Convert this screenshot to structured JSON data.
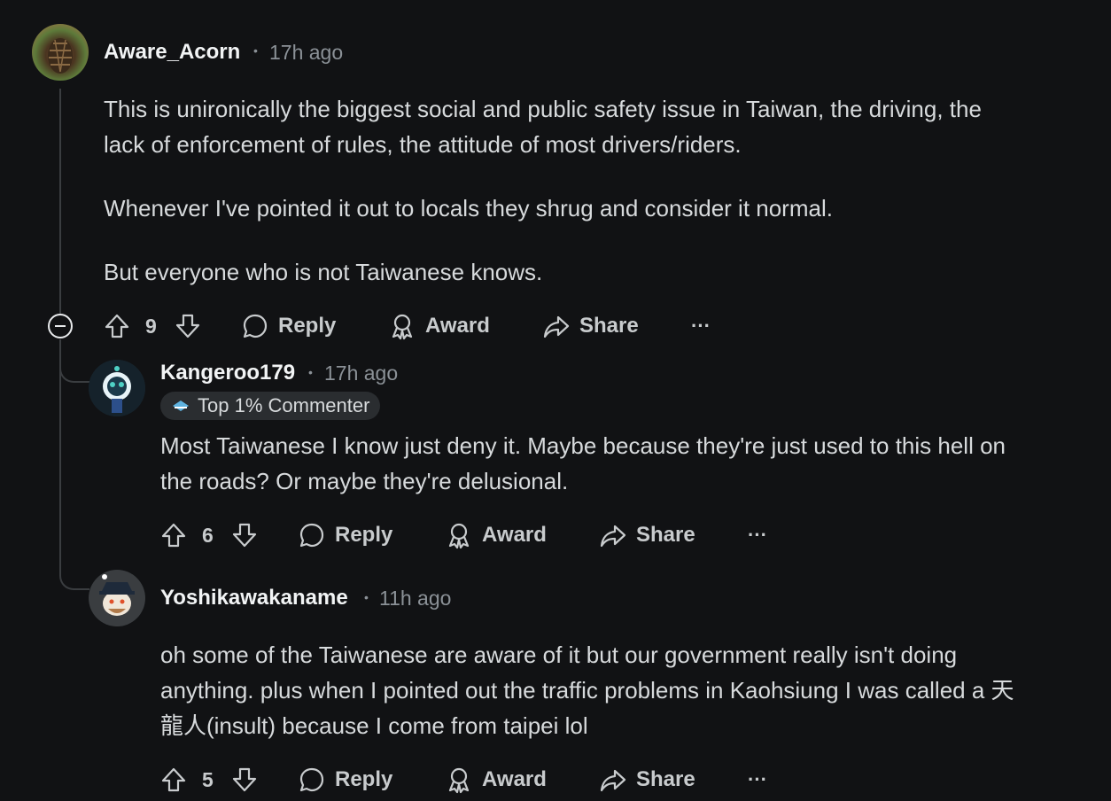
{
  "comments": [
    {
      "username": "Aware_Acorn",
      "time": "17h ago",
      "body": [
        "This is unironically the biggest social and public safety issue in Taiwan, the driving, the",
        "lack of enforcement of rules, the attitude of most drivers/riders.",
        "Whenever I've pointed it out to locals they shrug and consider it normal.",
        "But everyone who is not Taiwanese knows."
      ],
      "votes": "9",
      "icon": "pinecone-avatar"
    },
    {
      "username": "Kangeroo179",
      "time": "17h ago",
      "badge": "Top 1% Commenter",
      "body": [
        "Most Taiwanese I know just deny it. Maybe because they're just used to this hell on",
        "the roads? Or maybe they're delusional."
      ],
      "votes": "6",
      "icon": "snoo-avatar"
    },
    {
      "username": "Yoshikawakaname",
      "time": "11h ago",
      "body": [
        "oh some of the Taiwanese are aware of it but our government really isn't doing",
        "anything. plus when I pointed out the traffic problems in Kaohsiung I was called a 天",
        "龍人(insult) because I come from taipei lol"
      ],
      "votes": "5",
      "icon": "snoo-hat-avatar"
    }
  ],
  "actions": {
    "reply": "Reply",
    "award": "Award",
    "share": "Share",
    "more": "···"
  },
  "separator": "•"
}
